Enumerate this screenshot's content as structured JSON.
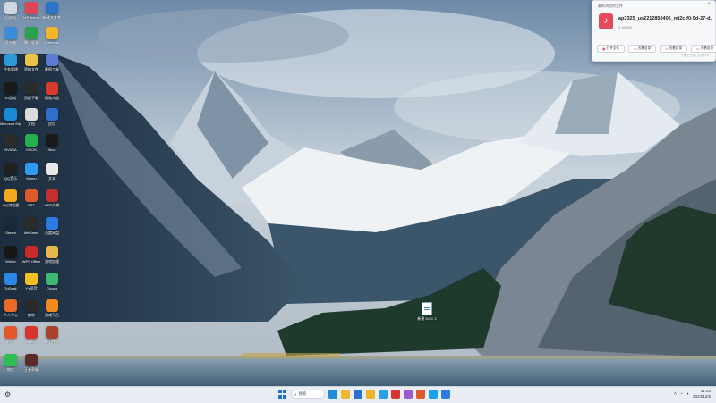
{
  "desktop": {
    "icons": [
      {
        "label": "回收站",
        "color": "#cfd8e0"
      },
      {
        "label": "MSTeams",
        "color": "#e04555"
      },
      {
        "label": "新建文件夹",
        "color": "#2b74c8"
      },
      {
        "label": "此电脑",
        "color": "#3a8bd8"
      },
      {
        "label": "腾讯管家",
        "color": "#2aa14a"
      },
      {
        "label": "Chrome",
        "color": "#f2b428"
      },
      {
        "label": "任务管理",
        "color": "#2a9ad6"
      },
      {
        "label": "资料文件",
        "color": "#e9c24a"
      },
      {
        "label": "截图工具",
        "color": "#5a7bd1"
      },
      {
        "label": "IG游戏",
        "color": "#1a1a1a"
      },
      {
        "label": "迅雷下载",
        "color": "#2b2b2b"
      },
      {
        "label": "植物大战",
        "color": "#d83b2c"
      },
      {
        "label": "Microsoft Edge",
        "color": "#1a8ad4"
      },
      {
        "label": "文档",
        "color": "#dcdcdc"
      },
      {
        "label": "应用",
        "color": "#2f6fd0"
      },
      {
        "label": "NVIDIA",
        "color": "#2c2c2c"
      },
      {
        "label": "GOOK",
        "color": "#22b14c"
      },
      {
        "label": "Xbox",
        "color": "#1a1a1a"
      },
      {
        "label": "QQ音乐",
        "color": "#202020"
      },
      {
        "label": "Mumu",
        "color": "#2d9bf0"
      },
      {
        "label": "文本",
        "color": "#e8e8e8"
      },
      {
        "label": "QQ浏览器",
        "color": "#f3a91c"
      },
      {
        "label": "PPT",
        "color": "#e05b2c"
      },
      {
        "label": "WPS文件",
        "color": "#c12f2f"
      },
      {
        "label": "Steam",
        "color": "#1b2838"
      },
      {
        "label": "WeGame",
        "color": "#2b2b2b"
      },
      {
        "label": "百度网盘",
        "color": "#2d7ae0"
      },
      {
        "label": "WeMe",
        "color": "#151515"
      },
      {
        "label": "WPS Office",
        "color": "#c82a2a"
      },
      {
        "label": "游戏加速",
        "color": "#e8b74a"
      },
      {
        "label": "ToDesk",
        "color": "#2b86e8"
      },
      {
        "label": "YY语音",
        "color": "#f0c020"
      },
      {
        "label": "Clouds",
        "color": "#3db870"
      },
      {
        "label": "个人中心",
        "color": "#e96a2a"
      },
      {
        "label": "剪映",
        "color": "#2a2a2a"
      },
      {
        "label": "游戏平台",
        "color": "#f08a1c"
      },
      {
        "label": "抖音",
        "color": "#e2582a"
      },
      {
        "label": "网易云",
        "color": "#d8332f"
      },
      {
        "label": "炉石传说",
        "color": "#a8422a"
      },
      {
        "label": "微信",
        "color": "#2dbf54"
      },
      {
        "label": "王者荣耀",
        "color": "#5a2a2a"
      }
    ],
    "file": {
      "label": "新建 DOC 2"
    }
  },
  "notification": {
    "header": "最新浏览的文件",
    "close": "×",
    "file_name": "ap3325_us2212850406_mi2c-f0-5d-27-d...",
    "file_size": "2.46 MB",
    "buttons": [
      "打开文件",
      "去看目录",
      "去看目录",
      "去看目录"
    ],
    "footer": "下载已完成 点击打开"
  },
  "taskbar": {
    "search_label": "搜索",
    "left_icon": "⚙",
    "apps": [
      {
        "name": "edge",
        "color": "#1e8ad8"
      },
      {
        "name": "folder",
        "color": "#f0b632"
      },
      {
        "name": "store",
        "color": "#2c6fd0"
      },
      {
        "name": "chrome",
        "color": "#f2b428"
      },
      {
        "name": "browser",
        "color": "#2da0e8"
      },
      {
        "name": "wps",
        "color": "#d83434"
      },
      {
        "name": "pen",
        "color": "#9a5bd0"
      },
      {
        "name": "camera",
        "color": "#e05b2c"
      },
      {
        "name": "qq",
        "color": "#1aa0f0"
      },
      {
        "name": "mail",
        "color": "#2d7ae0"
      }
    ],
    "time": "21:03",
    "date": "2023/12/5"
  }
}
